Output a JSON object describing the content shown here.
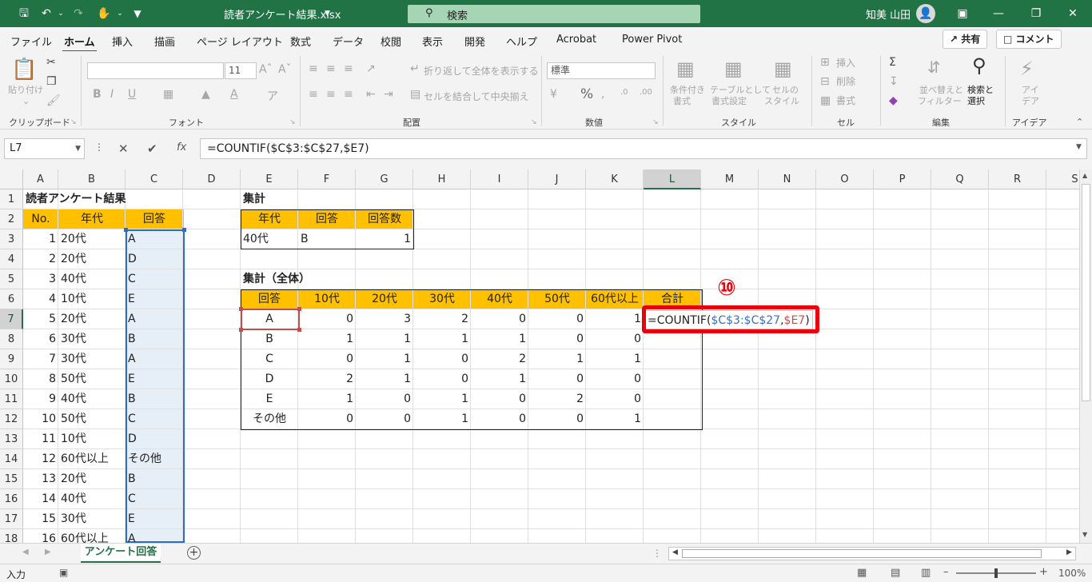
{
  "window": {
    "file_title": "読者アンケート結果.xlsx",
    "search_placeholder": "検索",
    "user_name": "知美 山田"
  },
  "menu": [
    "ファイル",
    "ホーム",
    "挿入",
    "描画",
    "ページ レイアウト",
    "数式",
    "データ",
    "校閲",
    "表示",
    "開発",
    "ヘルプ",
    "Acrobat",
    "Power Pivot"
  ],
  "share_label": "共有",
  "comment_label": "コメント",
  "ribbon": {
    "groups": [
      "クリップボード",
      "フォント",
      "配置",
      "数値",
      "スタイル",
      "セル",
      "編集",
      "アイデア"
    ],
    "paste": "貼り付け",
    "font_size": "11",
    "wrap_text": "折り返して全体を表示する",
    "merge_center": "セルを結合して中央揃え",
    "number_format": "標準",
    "cond_format": [
      "条件付き",
      "書式"
    ],
    "format_table": [
      "テーブルとして",
      "書式設定"
    ],
    "cell_style": [
      "セルの",
      "スタイル"
    ],
    "insert": "挿入",
    "delete": "削除",
    "format": "書式",
    "sort_filter": [
      "並べ替えと",
      "フィルター"
    ],
    "find_select": [
      "検索と",
      "選択"
    ],
    "ideas": [
      "アイ",
      "デア"
    ]
  },
  "formula_bar": {
    "name_box": "L7",
    "formula": "=COUNTIF($C$3:$C$27,$E7)"
  },
  "columns": [
    "A",
    "B",
    "C",
    "D",
    "E",
    "F",
    "G",
    "H",
    "I",
    "J",
    "K",
    "L",
    "M",
    "N",
    "O",
    "P",
    "Q",
    "R",
    "S"
  ],
  "rows": [
    "1",
    "2",
    "3",
    "4",
    "5",
    "6",
    "7",
    "8",
    "9",
    "10",
    "11",
    "12",
    "13",
    "14",
    "15",
    "16",
    "17",
    "18"
  ],
  "sheet": {
    "title": "読者アンケート結果",
    "headers": [
      "No.",
      "年代",
      "回答"
    ],
    "records": [
      [
        "1",
        "20代",
        "A"
      ],
      [
        "2",
        "20代",
        "D"
      ],
      [
        "3",
        "40代",
        "C"
      ],
      [
        "4",
        "10代",
        "E"
      ],
      [
        "5",
        "20代",
        "A"
      ],
      [
        "6",
        "30代",
        "B"
      ],
      [
        "7",
        "30代",
        "A"
      ],
      [
        "8",
        "50代",
        "E"
      ],
      [
        "9",
        "40代",
        "B"
      ],
      [
        "10",
        "50代",
        "C"
      ],
      [
        "11",
        "10代",
        "D"
      ],
      [
        "12",
        "60代以上",
        "その他"
      ],
      [
        "13",
        "20代",
        "B"
      ],
      [
        "14",
        "40代",
        "C"
      ],
      [
        "15",
        "30代",
        "E"
      ],
      [
        "16",
        "60代以上",
        "A"
      ]
    ],
    "summary_title": "集計",
    "summary_headers": [
      "年代",
      "回答",
      "回答数"
    ],
    "summary_row": [
      "40代",
      "B",
      "1"
    ],
    "total_title": "集計（全体）",
    "total_headers": [
      "回答",
      "10代",
      "20代",
      "30代",
      "40代",
      "50代",
      "60代以上",
      "合計"
    ],
    "total_rows": [
      [
        "A",
        "0",
        "3",
        "2",
        "0",
        "0",
        "1"
      ],
      [
        "B",
        "1",
        "1",
        "1",
        "1",
        "0",
        "0"
      ],
      [
        "C",
        "0",
        "1",
        "0",
        "2",
        "1",
        "1"
      ],
      [
        "D",
        "2",
        "1",
        "0",
        "1",
        "0",
        "0"
      ],
      [
        "E",
        "1",
        "0",
        "1",
        "0",
        "2",
        "0"
      ],
      [
        "その他",
        "0",
        "0",
        "1",
        "0",
        "0",
        "1"
      ]
    ],
    "editing_formula": {
      "prefix": "=COUNTIF(",
      "range": "$C$3:$C$27",
      "comma": ",",
      "ref": "$E7",
      "suffix": ")"
    },
    "callout_number": "⑩"
  },
  "sheet_tab": "アンケート回答",
  "status": {
    "mode": "入力",
    "zoom": "100%"
  }
}
